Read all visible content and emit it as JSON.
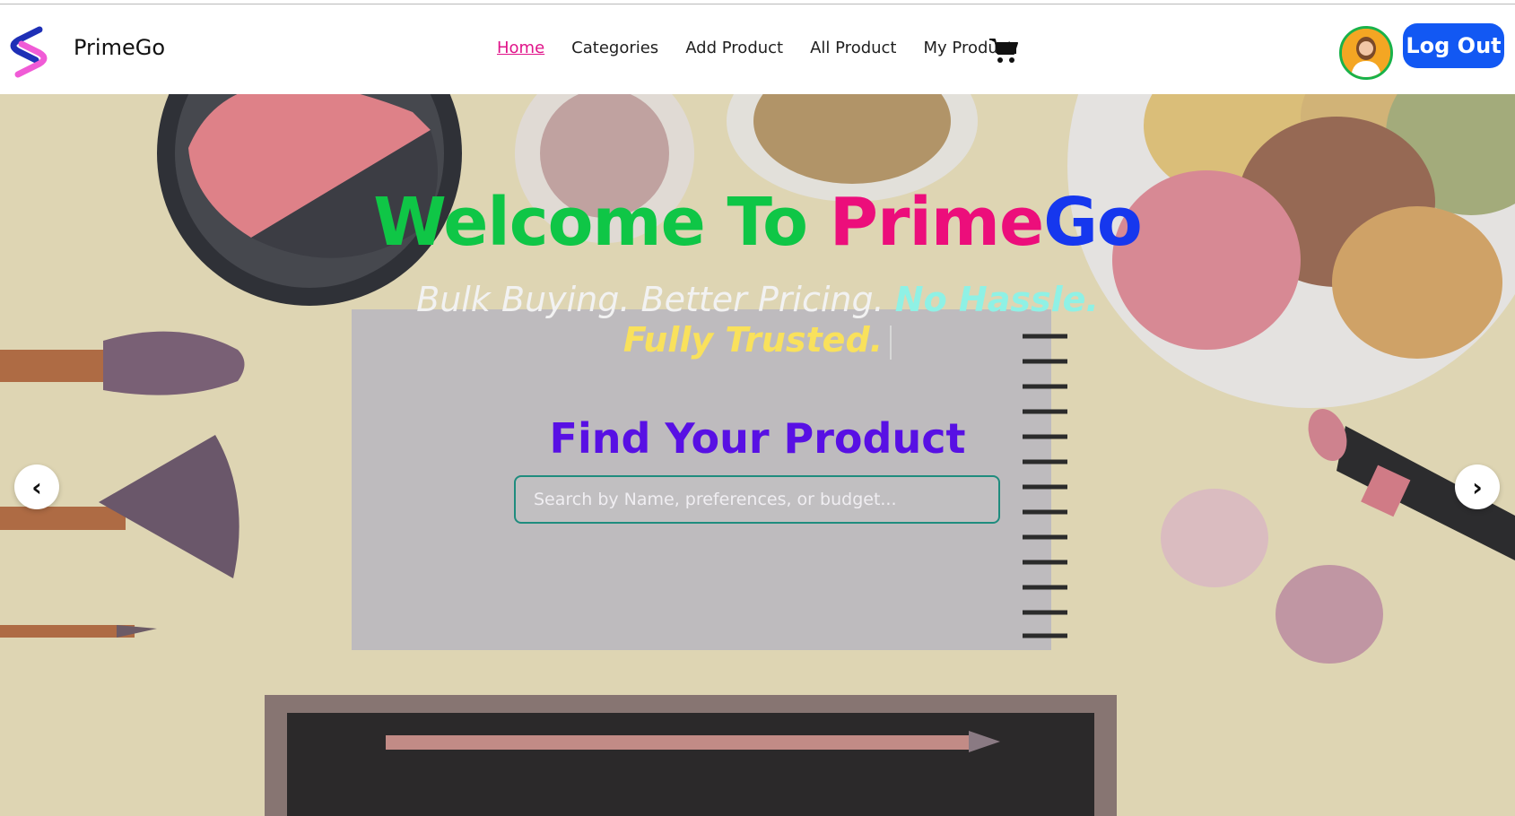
{
  "brand": {
    "name": "PrimeGo"
  },
  "nav": {
    "items": [
      {
        "label": "Home",
        "active": true
      },
      {
        "label": "Categories"
      },
      {
        "label": "Add Product"
      },
      {
        "label": "All Product"
      },
      {
        "label": "My Product"
      }
    ],
    "cart_icon": "shopping-cart-icon",
    "logout_label": "Log Out"
  },
  "hero": {
    "welcome_part1": "Welcome To ",
    "welcome_part2": "Prime",
    "welcome_part3": "Go",
    "tagline_part1": "Bulk Buying. Better Pricing. ",
    "tagline_part2": "No Hassle.",
    "tagline_part3": "Fully Trusted.",
    "find_title": "Find Your Product",
    "search_placeholder": "Search by Name, preferences, or budget...",
    "prev_label": "‹",
    "next_label": "›"
  },
  "colors": {
    "accent_green": "#0fc646",
    "accent_pink": "#ec0e7b",
    "accent_blue": "#1637ee",
    "logout_bg": "#1258f3",
    "find_title": "#5810e4"
  }
}
